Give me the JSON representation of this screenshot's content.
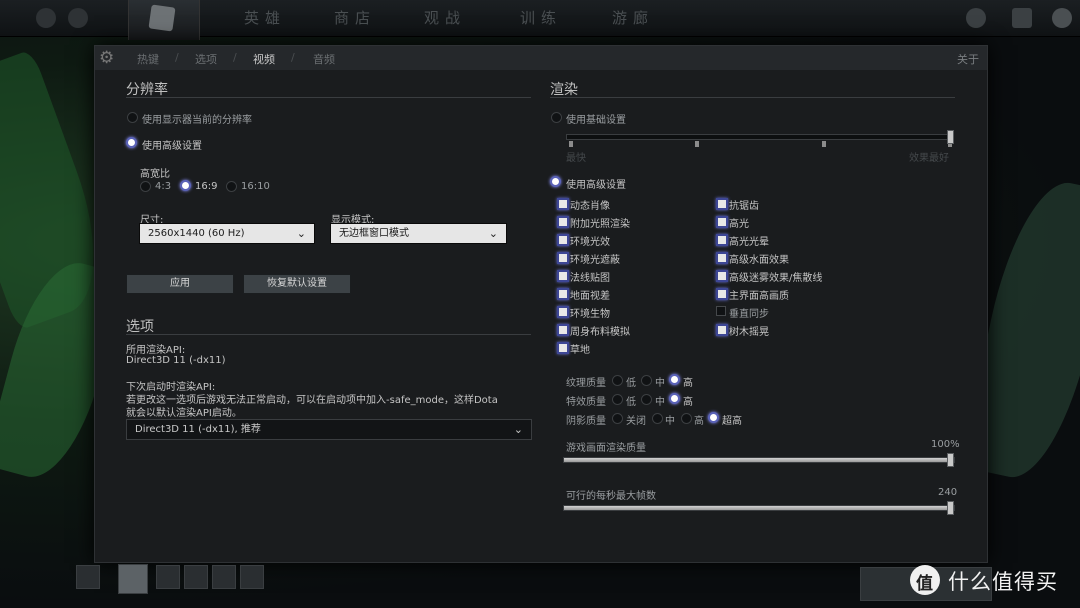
{
  "topnav": {
    "items": [
      "英雄",
      "商店",
      "观战",
      "训练",
      "游廊"
    ]
  },
  "tabs": {
    "hotkeys": "热键",
    "options": "选项",
    "video": "视频",
    "audio": "音频",
    "sep": "/",
    "about": "关于"
  },
  "resolution": {
    "title": "分辨率",
    "use_display": "使用显示器当前的分辨率",
    "use_advanced": "使用高级设置",
    "aspect_label": "高宽比",
    "aspect_options": [
      "4:3",
      "16:9",
      "16:10"
    ],
    "size_label": "尺寸:",
    "size_value": "2560x1440 (60 Hz)",
    "mode_label": "显示模式:",
    "mode_value": "无边框窗口模式",
    "apply": "应用",
    "restore": "恢复默认设置"
  },
  "options_section": {
    "title": "选项",
    "api_label": "所用渲染API:",
    "api_value": "Direct3D 11 (-dx11)",
    "next_label": "下次启动时渲染API:",
    "next_desc_1": "若更改这一选项后游戏无法正常启动，可以在启动项中加入-safe_mode，这样Dota",
    "next_desc_2": "就会以默认渲染API启动。",
    "next_value": "Direct3D 11 (-dx11), 推荐"
  },
  "render": {
    "title": "渲染",
    "use_basic": "使用基础设置",
    "basic_left": "最快",
    "basic_right": "效果最好",
    "use_advanced": "使用高级设置",
    "left_checks": [
      "动态肖像",
      "附加光照渲染",
      "环境光效",
      "环境光遮蔽",
      "法线贴图",
      "地面视差",
      "环境生物",
      "周身布料模拟",
      "草地"
    ],
    "right_checks": [
      "抗锯齿",
      "高光",
      "高光光晕",
      "高级水面效果",
      "高级迷雾效果/焦散线",
      "主界面高画质",
      "垂直同步",
      "树木摇晃"
    ],
    "right_checked": [
      true,
      true,
      true,
      true,
      true,
      true,
      false,
      true
    ],
    "texture_label": "纹理质量",
    "effects_label": "特效质量",
    "shadow_label": "阴影质量",
    "low": "低",
    "mid": "中",
    "high": "高",
    "off": "关闭",
    "ultra": "超高",
    "render_quality_label": "游戏画面渲染质量",
    "render_quality_value": "100%",
    "render_quality_pct": 100,
    "fps_label": "可行的每秒最大帧数",
    "fps_value": "240",
    "fps_pct": 100
  },
  "watermark": {
    "text": "什么值得买",
    "icon": "值"
  },
  "colors": {
    "accent": "#5a62b8",
    "checkbox_border": "#3d4695"
  }
}
